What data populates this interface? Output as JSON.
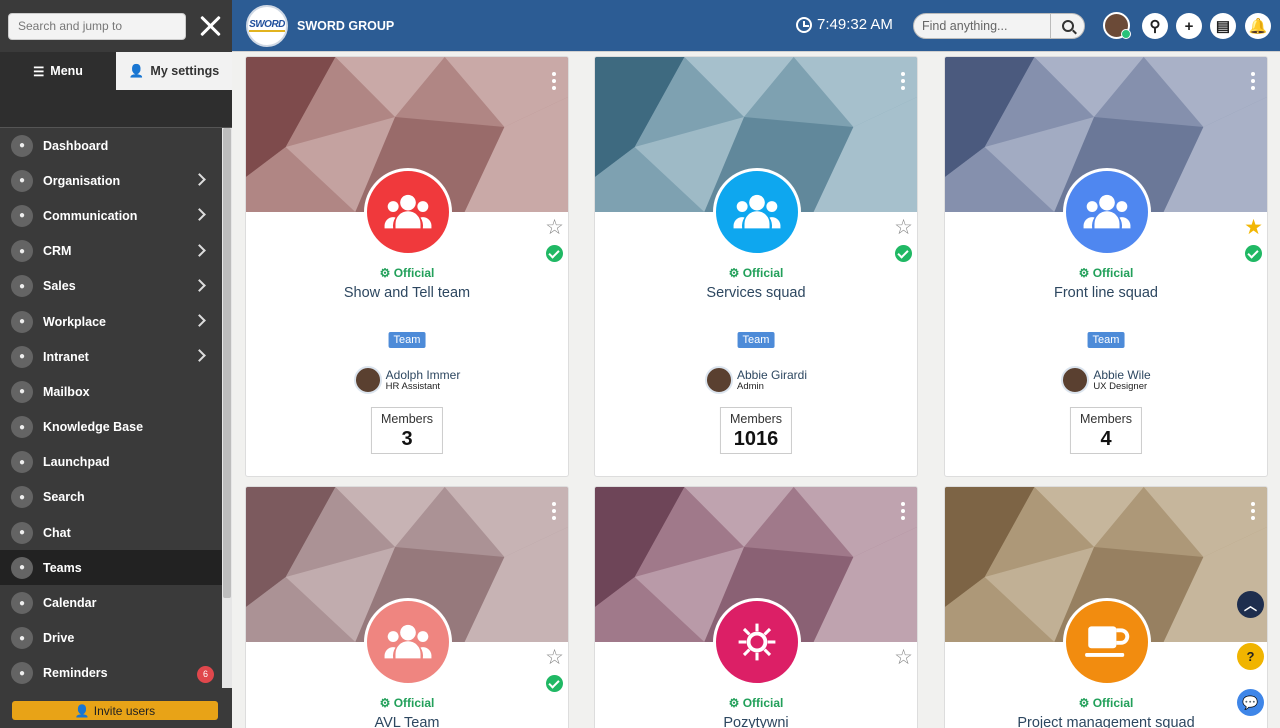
{
  "sidebar": {
    "search_placeholder": "Search and jump to",
    "tabs": {
      "menu": "Menu",
      "settings": "My settings"
    },
    "items": [
      {
        "label": "Dashboard",
        "icon": "home-icon",
        "chevron": false
      },
      {
        "label": "Organisation",
        "icon": "people-icon",
        "chevron": true
      },
      {
        "label": "Communication",
        "icon": "megaphone-icon",
        "chevron": true
      },
      {
        "label": "CRM",
        "icon": "crm-icon",
        "chevron": true
      },
      {
        "label": "Sales",
        "icon": "sales-icon",
        "chevron": true
      },
      {
        "label": "Workplace",
        "icon": "workplace-icon",
        "chevron": true
      },
      {
        "label": "Intranet",
        "icon": "intranet-icon",
        "chevron": true
      },
      {
        "label": "Mailbox",
        "icon": "mailbox-icon",
        "chevron": false
      },
      {
        "label": "Knowledge Base",
        "icon": "folder-icon",
        "chevron": false
      },
      {
        "label": "Launchpad",
        "icon": "rocket-icon",
        "chevron": false
      },
      {
        "label": "Search",
        "icon": "search-icon",
        "chevron": false
      },
      {
        "label": "Chat",
        "icon": "chat-icon",
        "chevron": false
      },
      {
        "label": "Teams",
        "icon": "teams-icon",
        "chevron": false,
        "active": true
      },
      {
        "label": "Calendar",
        "icon": "calendar-icon",
        "chevron": false
      },
      {
        "label": "Drive",
        "icon": "drive-icon",
        "chevron": false
      },
      {
        "label": "Reminders",
        "icon": "reminder-icon",
        "chevron": false,
        "badge": "6"
      }
    ],
    "invite": "Invite users"
  },
  "topbar": {
    "logo_text": "SWORD",
    "brand": "SWORD GROUP",
    "time": "7:49:32 AM",
    "find_placeholder": "Find anything..."
  },
  "cards": [
    {
      "official": "Official",
      "name": "Show and Tell team",
      "tag": "Team",
      "person": "Adolph Immer",
      "role": "HR Assistant",
      "members_label": "Members",
      "members": "3",
      "circle_color": "#f0393c",
      "icon": "team-icon",
      "starred": false,
      "bg": [
        "#7e4b4c",
        "#b08684",
        "#c9a9a7"
      ]
    },
    {
      "official": "Official",
      "name": "Services squad",
      "tag": "Team",
      "person": "Abbie Girardi",
      "role": "Admin",
      "members_label": "Members",
      "members": "1016",
      "circle_color": "#0ea7ef",
      "icon": "team-icon",
      "starred": false,
      "bg": [
        "#3e6a80",
        "#7ea1b1",
        "#a6c0cc"
      ]
    },
    {
      "official": "Official",
      "name": "Front line squad",
      "tag": "Team",
      "person": "Abbie Wile",
      "role": "UX Designer",
      "members_label": "Members",
      "members": "4",
      "circle_color": "#4f87f0",
      "icon": "team-icon",
      "starred": true,
      "bg": [
        "#4b5a7e",
        "#8590ad",
        "#a9b1c7"
      ]
    },
    {
      "official": "Official",
      "name": "AVL Team",
      "circle_color": "#ef8580",
      "icon": "team-icon",
      "starred": false,
      "bg": [
        "#7c5a5e",
        "#ab9295",
        "#c7b3b4"
      ]
    },
    {
      "official": "Official",
      "name": "Pozytywni",
      "circle_color": "#dc1f66",
      "icon": "sun-icon",
      "starred": false,
      "bg": [
        "#6e4558",
        "#a0798a",
        "#bfa3af"
      ]
    },
    {
      "official": "Official",
      "name": "Project management squad",
      "circle_color": "#f28c0f",
      "icon": "coffee-icon",
      "starred": false,
      "bg": [
        "#7d6445",
        "#ad9878",
        "#c6b69c"
      ]
    }
  ]
}
